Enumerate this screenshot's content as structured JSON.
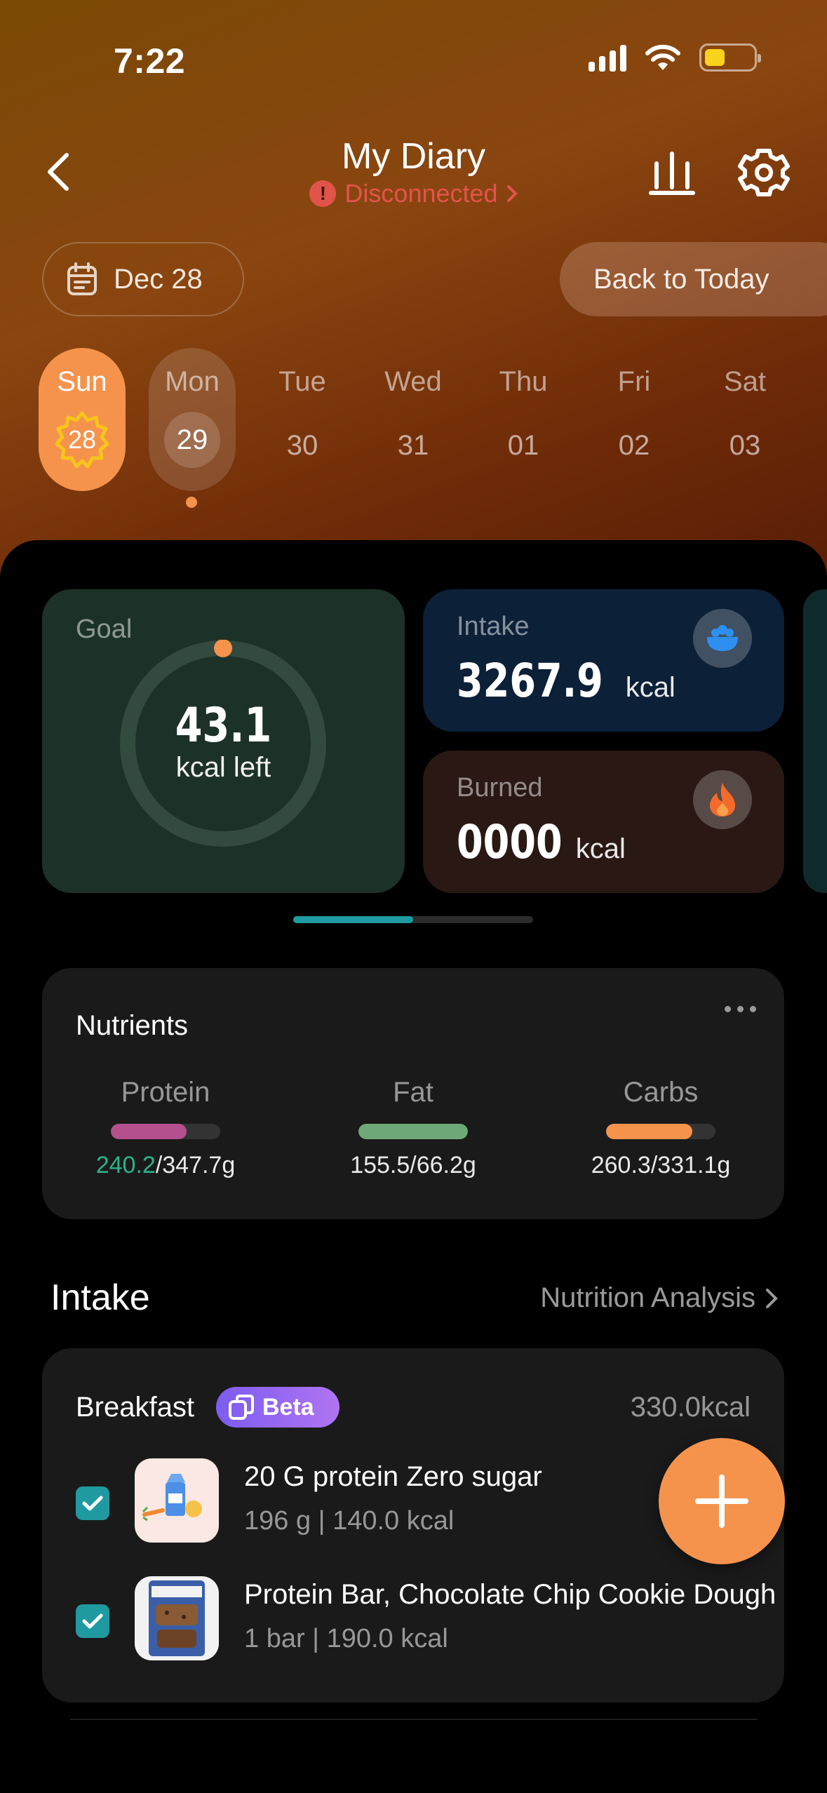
{
  "status_bar": {
    "time": "7:22"
  },
  "header": {
    "title": "My Diary",
    "connection_status": "Disconnected",
    "connection_color": "#e2544a"
  },
  "date_selector": {
    "selected_date": "Dec 28",
    "back_to_today": "Back to Today"
  },
  "week": [
    {
      "name": "Sun",
      "num": "28"
    },
    {
      "name": "Mon",
      "num": "29"
    },
    {
      "name": "Tue",
      "num": "30"
    },
    {
      "name": "Wed",
      "num": "31"
    },
    {
      "name": "Thu",
      "num": "01"
    },
    {
      "name": "Fri",
      "num": "02"
    },
    {
      "name": "Sat",
      "num": "03"
    }
  ],
  "summary": {
    "goal": {
      "label": "Goal",
      "value": "43.1",
      "unit": "kcal left"
    },
    "intake": {
      "label": "Intake",
      "value": "3267.9",
      "unit": "kcal"
    },
    "burned": {
      "label": "Burned",
      "value": "0000",
      "unit": "kcal"
    },
    "pager_progress": 0.5
  },
  "nutrients": {
    "title": "Nutrients",
    "items": [
      {
        "name": "Protein",
        "consumed": "240.2",
        "target": "/347.7g",
        "fraction": 0.69,
        "color": "#b4508e"
      },
      {
        "name": "Fat",
        "value": "155.5/66.2g",
        "fraction": 1.0,
        "color": "#6fa878"
      },
      {
        "name": "Carbs",
        "value": "260.3/331.1g",
        "fraction": 0.79,
        "color": "#f5934d"
      }
    ]
  },
  "intake_section": {
    "title": "Intake",
    "analysis_link": "Nutrition Analysis"
  },
  "meal": {
    "name": "Breakfast",
    "badge": "Beta",
    "total": "330.0kcal",
    "foods": [
      {
        "name": "20 G protein Zero  sugar",
        "meta": "196 g | 140.0 kcal",
        "checked": true
      },
      {
        "name": "Protein Bar, Chocolate Chip Cookie Dough",
        "meta": "1 bar | 190.0 kcal",
        "checked": true
      }
    ]
  },
  "colors": {
    "accent": "#f5934d",
    "teal": "#1f9aa0",
    "goal_card": "#1c3228",
    "intake_card": "#0c2038",
    "burned_card": "#2a1814"
  }
}
